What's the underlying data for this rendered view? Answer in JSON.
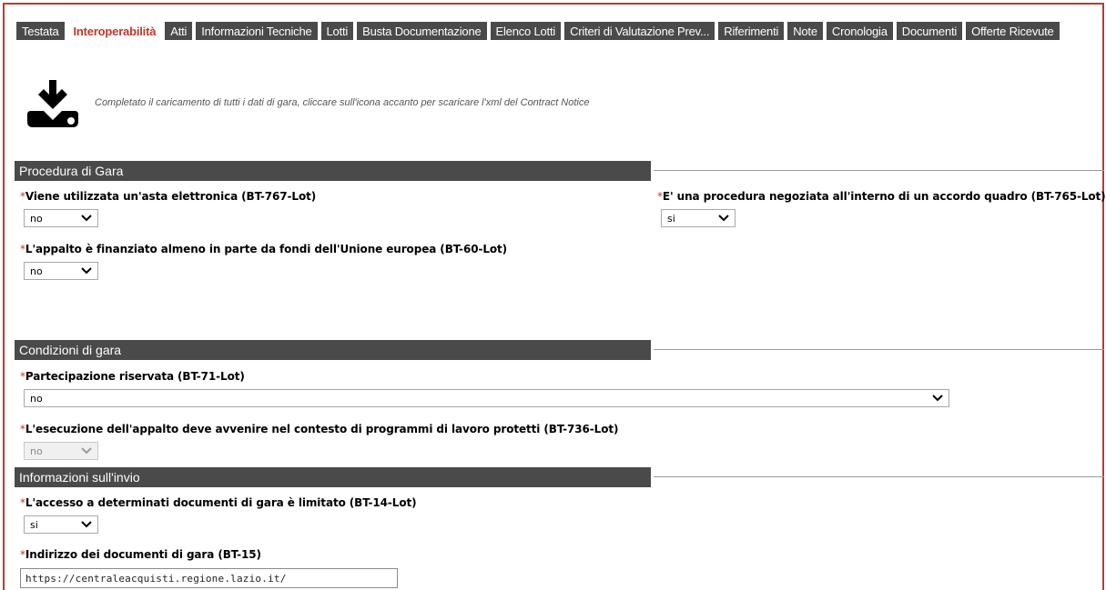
{
  "tabs": [
    {
      "label": "Testata",
      "active": false
    },
    {
      "label": "Interoperabilità",
      "active": true
    },
    {
      "label": "Atti",
      "active": false
    },
    {
      "label": "Informazioni Tecniche",
      "active": false
    },
    {
      "label": "Lotti",
      "active": false
    },
    {
      "label": "Busta Documentazione",
      "active": false
    },
    {
      "label": "Elenco Lotti",
      "active": false
    },
    {
      "label": "Criteri di Valutazione Prev...",
      "active": false
    },
    {
      "label": "Riferimenti",
      "active": false
    },
    {
      "label": "Note",
      "active": false
    },
    {
      "label": "Cronologia",
      "active": false
    },
    {
      "label": "Documenti",
      "active": false
    },
    {
      "label": "Offerte Ricevute",
      "active": false
    }
  ],
  "download": {
    "icon": "download-icon",
    "text": "Completato il caricamento di tutti i dati di gara, cliccare sull'icona accanto per scaricare l'xml del Contract Notice"
  },
  "sections": {
    "procedura": {
      "title": "Procedura di Gara",
      "asta_label": "Viene utilizzata un'asta elettronica (BT-767-Lot)",
      "asta_value": "no",
      "accordo_label": "E' una procedura negoziata all'interno di un accordo quadro (BT-765-Lot)",
      "accordo_value": "si",
      "fondi_label": "L'appalto è finanziato almeno in parte da fondi dell'Unione europea (BT-60-Lot)",
      "fondi_value": "no"
    },
    "condizioni": {
      "title": "Condizioni di gara",
      "riservata_label": "Partecipazione riservata (BT-71-Lot)",
      "riservata_value": "no",
      "protetti_label": "L'esecuzione dell'appalto deve avvenire nel contesto di programmi di lavoro protetti (BT-736-Lot)",
      "protetti_value": "no"
    },
    "invio": {
      "title": "Informazioni sull'invio",
      "accesso_label": "L'accesso a determinati documenti di gara è limitato (BT-14-Lot)",
      "accesso_value": "si",
      "indirizzo_label": "Indirizzo dei documenti di gara (BT-15)",
      "indirizzo_value": "https://centraleacquisti.regione.lazio.it/"
    }
  },
  "required_marker": "*",
  "colors": {
    "tab_bg": "#4a4a4a",
    "active_tab_text": "#c0392b",
    "frame_border": "#c0392b",
    "required": "#c0392b"
  }
}
